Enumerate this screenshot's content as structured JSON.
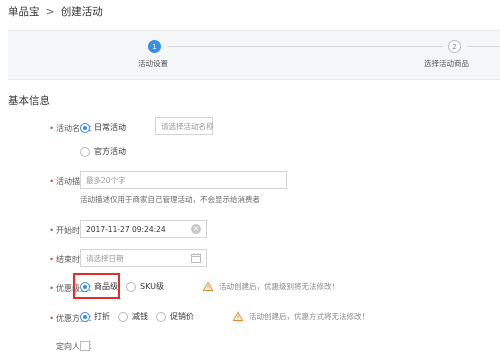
{
  "breadcrumb": {
    "root": "单品宝",
    "separator": ">",
    "current": "创建活动"
  },
  "steps": [
    {
      "number": "1",
      "label": "活动设置",
      "active": true
    },
    {
      "number": "2",
      "label": "选择活动商品",
      "active": false
    }
  ],
  "section_title": "基本信息",
  "form": {
    "activity_name": {
      "label": "活动名称：",
      "options": [
        "日常活动",
        "官方活动"
      ],
      "selected": "日常活动",
      "placeholder": "请选择活动名称"
    },
    "activity_desc": {
      "label": "活动描述：",
      "placeholder": "最多20个字",
      "hint": "活动描述仅用于商家自己管理活动，不会显示给消费者"
    },
    "start_time": {
      "label": "开始时间：",
      "value": "2017-11-27 09:24:24"
    },
    "end_time": {
      "label": "结束时间：",
      "placeholder": "请选择日期"
    },
    "discount_level": {
      "label": "优惠级别：",
      "options": [
        "商品级",
        "SKU级"
      ],
      "selected": "商品级",
      "warning": "活动创建后，优惠级别将无法修改！"
    },
    "discount_method": {
      "label": "优惠方式：",
      "options": [
        "打折",
        "减钱",
        "促销价"
      ],
      "selected": "打折",
      "warning": "活动创建后，优惠方式将无法修改！"
    },
    "target_group": {
      "label": "定向人群：",
      "checked": false
    }
  },
  "colors": {
    "accent": "#3a8ee6",
    "required": "#e4393c",
    "highlight": "#e0302d",
    "warning": "#f08a24"
  },
  "icons": {
    "warning": "warning-triangle-icon",
    "calendar": "calendar-icon",
    "clear": "clear-icon"
  }
}
